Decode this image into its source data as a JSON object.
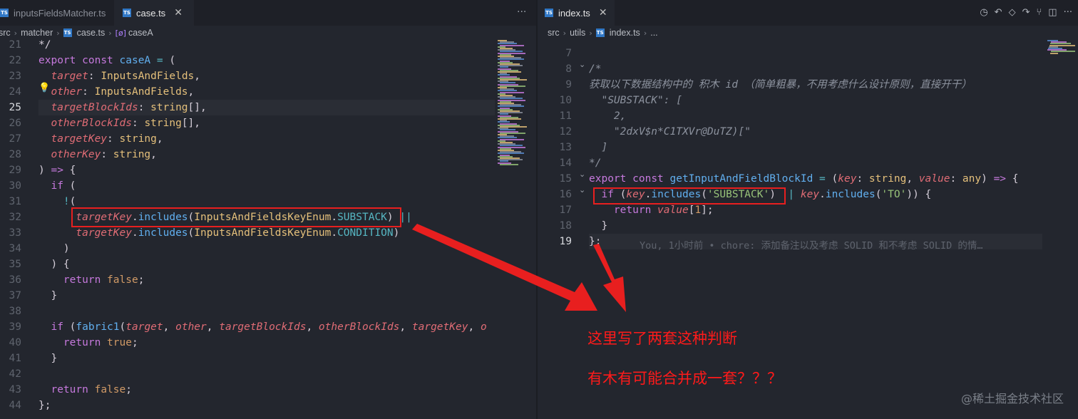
{
  "left_editor": {
    "tabs": [
      {
        "label": "inputsFieldsMatcher.ts",
        "active": false
      },
      {
        "label": "case.ts",
        "active": true
      }
    ],
    "more_icon": "ellipsis-icon",
    "breadcrumb": [
      "src",
      "matcher",
      "case.ts",
      "caseA"
    ],
    "current_line": 25
  },
  "right_editor": {
    "tabs": [
      {
        "label": "index.ts",
        "active": true
      }
    ],
    "breadcrumb": [
      "src",
      "utils",
      "index.ts",
      "..."
    ],
    "toolbar_icons": [
      "history-icon",
      "go-back-icon",
      "circle-icon",
      "go-forward-icon",
      "git-graph-icon",
      "split-editor-icon",
      "more-actions-icon"
    ],
    "current_line": 19,
    "blame": "You, 1小时前 • chore: 添加备注以及考虑 SOLID 和不考虑 SOLID 的情…"
  },
  "annotations": {
    "line1": "这里写了两套这种判断",
    "line2": "有木有可能合并成一套？？？",
    "arrow_color": "#e81f1f"
  },
  "watermark": "@稀土掘金技术社区",
  "colors": {
    "background": "#23262e",
    "tabbar": "#1e2027",
    "highlight": "#e81f1f",
    "ts_badge": "#3178c6"
  }
}
